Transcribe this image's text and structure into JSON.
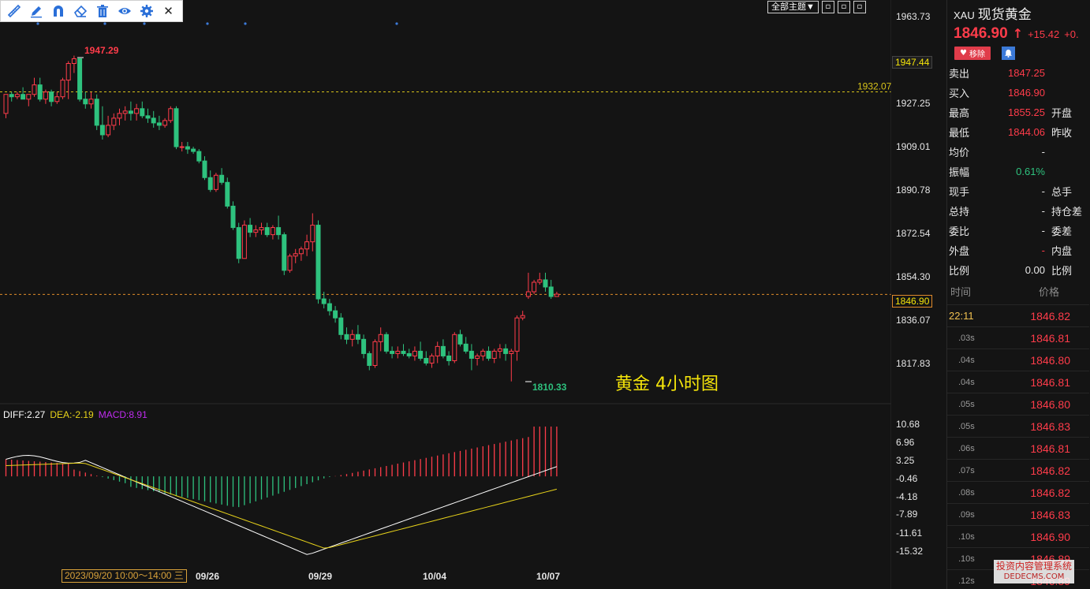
{
  "toolbar": {
    "items": [
      "ruler-icon",
      "pen-icon",
      "magnet-icon",
      "eraser-icon",
      "trash-icon",
      "eye-icon",
      "gear-icon",
      "close-icon"
    ],
    "close_glyph": "✕"
  },
  "theme": {
    "select_label": "全部主题▼",
    "win_icons": [
      "restore-icon",
      "maximize-icon",
      "close-icon"
    ]
  },
  "price_axis": {
    "ticks": [
      "1963.73",
      "1927.25",
      "1909.01",
      "1890.78",
      "1872.54",
      "1854.30",
      "1836.07",
      "1817.83"
    ],
    "badge_high": "1947.44",
    "badge_current": "1846.90",
    "line_label": "1932.07"
  },
  "macd_axis": {
    "ticks": [
      "10.68",
      "6.96",
      "3.25",
      "-0.46",
      "-4.18",
      "-7.89",
      "-11.61",
      "-15.32"
    ]
  },
  "macd_legend": {
    "diff": "DIFF:2.27",
    "dea": "DEA:-2.19",
    "macd": "MACD:8.91"
  },
  "chart_labels": {
    "high": "1947.29",
    "low": "1810.33"
  },
  "annotation": "黄金 4小时图",
  "x_axis": {
    "time_range": "2023/09/20 10:00～14:00 三",
    "dates": [
      "09/26",
      "09/29",
      "10/04",
      "10/07"
    ]
  },
  "colors": {
    "up": "#ff3c4a",
    "down": "#2ec27e",
    "diff": "#ffffff",
    "dea": "#e8d31a",
    "macd": "#c02cf0",
    "guide": "#d6c21a"
  },
  "chart_data": {
    "type": "candlestick",
    "title": "黄金 4小时图",
    "ylim": [
      1805,
      1968
    ],
    "hline": 1932.07,
    "current_price": 1846.9,
    "high_marker": 1947.29,
    "low_marker": 1810.33,
    "candles": [
      [
        1923,
        1931,
        1921,
        1931
      ],
      [
        1931,
        1932,
        1928,
        1930
      ],
      [
        1930,
        1932,
        1929,
        1931
      ],
      [
        1931,
        1934,
        1929,
        1929
      ],
      [
        1929,
        1931,
        1926,
        1931
      ],
      [
        1931,
        1938,
        1930,
        1935
      ],
      [
        1935,
        1938,
        1928,
        1929
      ],
      [
        1929,
        1933,
        1927,
        1932
      ],
      [
        1932,
        1933,
        1926,
        1928
      ],
      [
        1928,
        1932,
        1927,
        1930
      ],
      [
        1930,
        1938,
        1929,
        1937
      ],
      [
        1937,
        1945,
        1929,
        1944
      ],
      [
        1944,
        1947.3,
        1940,
        1946
      ],
      [
        1946,
        1946,
        1928,
        1929
      ],
      [
        1929,
        1932,
        1925,
        1927
      ],
      [
        1927,
        1932,
        1925,
        1929
      ],
      [
        1929,
        1931,
        1916,
        1918
      ],
      [
        1918,
        1926,
        1912,
        1914
      ],
      [
        1914,
        1922,
        1913,
        1918
      ],
      [
        1918,
        1923,
        1916,
        1921
      ],
      [
        1921,
        1925,
        1918,
        1923
      ],
      [
        1923,
        1926,
        1920,
        1924
      ],
      [
        1924,
        1928,
        1920,
        1923
      ],
      [
        1923,
        1927,
        1920,
        1925
      ],
      [
        1925,
        1928,
        1921,
        1922
      ],
      [
        1922,
        1925,
        1919,
        1921
      ],
      [
        1921,
        1924,
        1917,
        1919
      ],
      [
        1919,
        1922,
        1916,
        1918
      ],
      [
        1918,
        1921,
        1917,
        1920
      ],
      [
        1920,
        1926,
        1919,
        1925
      ],
      [
        1925,
        1926,
        1908,
        1909
      ],
      [
        1909,
        1911,
        1907,
        1909
      ],
      [
        1909,
        1911,
        1906,
        1908
      ],
      [
        1908,
        1909,
        1906,
        1907
      ],
      [
        1907,
        1908,
        1902,
        1903
      ],
      [
        1903,
        1905,
        1895,
        1896
      ],
      [
        1896,
        1899,
        1890,
        1891
      ],
      [
        1891,
        1898,
        1890,
        1897
      ],
      [
        1897,
        1900,
        1893,
        1894
      ],
      [
        1894,
        1896,
        1883,
        1884
      ],
      [
        1884,
        1886,
        1874,
        1875
      ],
      [
        1875,
        1877,
        1860,
        1862
      ],
      [
        1862,
        1878,
        1862,
        1876
      ],
      [
        1876,
        1879,
        1871,
        1873
      ],
      [
        1873,
        1876,
        1871,
        1874
      ],
      [
        1874,
        1877,
        1872,
        1875
      ],
      [
        1875,
        1877,
        1871,
        1872
      ],
      [
        1872,
        1876,
        1870,
        1875
      ],
      [
        1875,
        1880,
        1870,
        1872
      ],
      [
        1872,
        1873,
        1855,
        1857
      ],
      [
        1857,
        1864,
        1856,
        1863
      ],
      [
        1863,
        1866,
        1860,
        1864
      ],
      [
        1864,
        1867,
        1861,
        1866
      ],
      [
        1866,
        1872,
        1863,
        1869
      ],
      [
        1869,
        1881,
        1865,
        1876
      ],
      [
        1876,
        1878,
        1843,
        1845
      ],
      [
        1845,
        1848,
        1841,
        1843
      ],
      [
        1843,
        1845,
        1838,
        1840
      ],
      [
        1840,
        1842,
        1835,
        1837
      ],
      [
        1837,
        1839,
        1828,
        1830
      ],
      [
        1830,
        1833,
        1826,
        1828
      ],
      [
        1828,
        1832,
        1825,
        1830
      ],
      [
        1830,
        1834,
        1826,
        1828
      ],
      [
        1828,
        1830,
        1820,
        1822
      ],
      [
        1822,
        1823,
        1815,
        1817
      ],
      [
        1817,
        1828,
        1816,
        1827
      ],
      [
        1827,
        1833,
        1823,
        1830
      ],
      [
        1830,
        1831,
        1822,
        1823
      ],
      [
        1823,
        1825,
        1820,
        1822
      ],
      [
        1822,
        1825,
        1820,
        1823
      ],
      [
        1823,
        1826,
        1821,
        1822
      ],
      [
        1822,
        1824,
        1820,
        1821
      ],
      [
        1821,
        1825,
        1819,
        1823
      ],
      [
        1823,
        1827,
        1819,
        1820
      ],
      [
        1820,
        1823,
        1817,
        1818
      ],
      [
        1818,
        1822,
        1816,
        1821
      ],
      [
        1821,
        1827,
        1818,
        1825
      ],
      [
        1825,
        1828,
        1820,
        1821
      ],
      [
        1821,
        1823,
        1817,
        1819
      ],
      [
        1819,
        1831,
        1818,
        1830
      ],
      [
        1830,
        1832,
        1825,
        1826
      ],
      [
        1826,
        1829,
        1822,
        1823
      ],
      [
        1823,
        1826,
        1815,
        1820
      ],
      [
        1820,
        1822,
        1817,
        1821
      ],
      [
        1821,
        1824,
        1819,
        1823
      ],
      [
        1823,
        1825,
        1819,
        1820
      ],
      [
        1820,
        1824,
        1818,
        1823
      ],
      [
        1823,
        1826,
        1820,
        1824
      ],
      [
        1824,
        1826,
        1819,
        1822
      ],
      [
        1822,
        1824,
        1810.3,
        1823
      ],
      [
        1823,
        1838,
        1819,
        1837
      ],
      [
        1837,
        1840,
        1836,
        1838
      ],
      [
        1846,
        1856,
        1845,
        1848
      ],
      [
        1848,
        1853,
        1847,
        1852
      ],
      [
        1852,
        1856,
        1851,
        1853
      ],
      [
        1853,
        1856,
        1848,
        1850
      ],
      [
        1850,
        1853,
        1845,
        1846
      ],
      [
        1846,
        1848,
        1846,
        1847
      ]
    ],
    "dates": [
      "09/26",
      "09/29",
      "10/04",
      "10/07"
    ],
    "macd": {
      "ylim": [
        -15.32,
        10.68
      ],
      "diff_last": 2.27,
      "dea_last": -2.19,
      "macd_last": 8.91
    }
  },
  "quote": {
    "code": "XAU",
    "name": "现货黄金",
    "price": "1846.90",
    "arrow": "↑",
    "change": "+15.42",
    "change_pct": "+0.",
    "remove_label": "移除",
    "rows": [
      {
        "k": "卖出",
        "v": "1847.25",
        "vc": "#ff3c4a",
        "k2": ""
      },
      {
        "k": "买入",
        "v": "1846.90",
        "vc": "#ff3c4a",
        "k2": ""
      },
      {
        "k": "最高",
        "v": "1855.25",
        "vc": "#ff3c4a",
        "k2": "开盘"
      },
      {
        "k": "最低",
        "v": "1844.06",
        "vc": "#ff3c4a",
        "k2": "昨收"
      },
      {
        "k": "均价",
        "v": "-",
        "vc": "#e8e8e8",
        "k2": ""
      },
      {
        "k": "振幅",
        "v": "0.61%",
        "vc": "#2ec27e",
        "k2": ""
      },
      {
        "k": "现手",
        "v": "-",
        "vc": "#e8e8e8",
        "k2": "总手"
      },
      {
        "k": "总持",
        "v": "-",
        "vc": "#e8e8e8",
        "k2": "持仓差"
      },
      {
        "k": "委比",
        "v": "-",
        "vc": "#e8e8e8",
        "k2": "委差"
      },
      {
        "k": "外盘",
        "v": "-",
        "vc": "#ff3c4a",
        "k2": "内盘"
      },
      {
        "k": "比例",
        "v": "0.00",
        "vc": "#e8e8e8",
        "k2": "比例"
      }
    ],
    "tick_header": {
      "time": "时间",
      "price": "价格"
    },
    "ticks": [
      {
        "t": "22:11",
        "p": "1846.82"
      },
      {
        "t": ".03s",
        "p": "1846.81"
      },
      {
        "t": ".04s",
        "p": "1846.80"
      },
      {
        "t": ".04s",
        "p": "1846.81"
      },
      {
        "t": ".05s",
        "p": "1846.80"
      },
      {
        "t": ".05s",
        "p": "1846.83"
      },
      {
        "t": ".06s",
        "p": "1846.81"
      },
      {
        "t": ".07s",
        "p": "1846.82"
      },
      {
        "t": ".08s",
        "p": "1846.82"
      },
      {
        "t": ".09s",
        "p": "1846.83"
      },
      {
        "t": ".10s",
        "p": "1846.90"
      },
      {
        "t": ".10s",
        "p": "1846.89"
      },
      {
        "t": ".12s",
        "p": "1846.89"
      }
    ]
  },
  "watermark": {
    "line1": "投资内容管理系统",
    "line2": "DEDECMS.COM"
  }
}
